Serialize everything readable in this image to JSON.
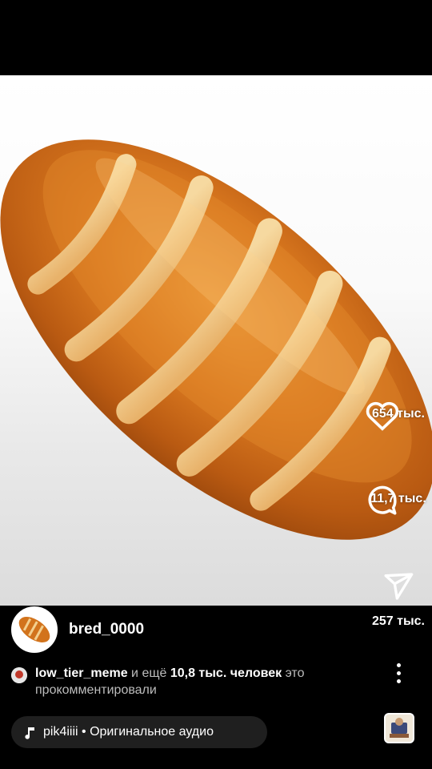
{
  "post": {
    "username": "bred_0000",
    "likes": "654 тыс.",
    "comments": "11,7 тыс.",
    "shares": "257 тыс."
  },
  "comment_summary": {
    "user": "low_tier_meme",
    "middle": " и ещё ",
    "count": "10,8 тыс. человек",
    "suffix": " это прокомментировали"
  },
  "audio": {
    "artist": "pik4iiii",
    "separator": " • ",
    "title": "Оригинальное аудио"
  },
  "icons": {
    "like": "heart-icon",
    "comment": "comment-icon",
    "share": "send-icon",
    "more": "more-vertical-icon",
    "audio": "music-note-icon"
  },
  "colors": {
    "background": "#000000",
    "text": "#ffffff",
    "secondary_text": "#bcbcbc",
    "pill": "#1f1f1f"
  }
}
